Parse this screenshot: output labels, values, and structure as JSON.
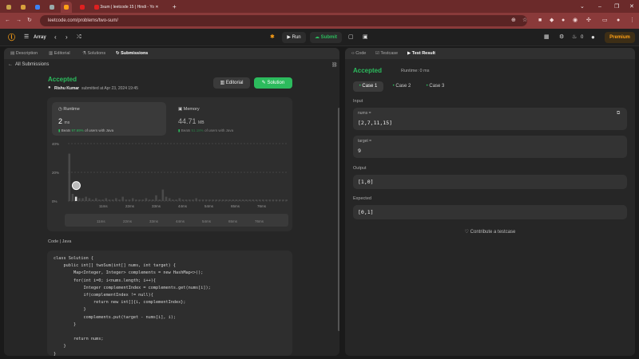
{
  "browser": {
    "tabs": [
      "3sum | leetcode 15 | Hindi - Yo"
    ],
    "url": "leetcode.com/problems/two-sum/"
  },
  "header": {
    "problem_list": "Array",
    "run": "Run",
    "submit": "Submit",
    "streak": "0",
    "premium": "Premium"
  },
  "left": {
    "tabs": [
      "Description",
      "Editorial",
      "Solutions",
      "Submissions"
    ],
    "back": "All Submissions",
    "status": "Accepted",
    "author": "Rishu Kumar",
    "submitted": "submitted at Apr 23, 2024 19:45",
    "editorial_btn": "Editorial",
    "solution_btn": "Solution",
    "runtime_label": "Runtime",
    "runtime_value": "2",
    "runtime_unit": "ms",
    "runtime_beats_prefix": "Beats",
    "runtime_beats": "97.69%",
    "runtime_beats_suffix": "of users with Java",
    "memory_label": "Memory",
    "memory_value": "44.71",
    "memory_unit": "MB",
    "memory_beats_prefix": "Beats",
    "memory_beats": "51.18%",
    "memory_beats_suffix": "of users with Java",
    "code_header": "Code",
    "code_lang": "Java",
    "code": [
      "class Solution {",
      "    public int[] twoSum(int[] nums, int target) {",
      "        Map<Integer, Integer> complements = new HashMap<>();",
      "        for(int i=0; i<nums.length; i++){",
      "            Integer complementIndex = complements.get(nums[i]);",
      "            if(complementIndex != null){",
      "                return new int[]{i, complementIndex};",
      "            }",
      "            complements.put(target - nums[i], i);",
      "        }",
      "",
      "        return nums;",
      "    }",
      "}"
    ]
  },
  "chart_data": {
    "type": "bar",
    "y_ticks": [
      "40%",
      "20%",
      "0%"
    ],
    "ylim": [
      0,
      40
    ],
    "x_ticks": [
      "11ms",
      "22ms",
      "33ms",
      "44ms",
      "54ms",
      "65ms",
      "76ms"
    ],
    "mini_ticks": [
      "11ms",
      "22ms",
      "33ms",
      "44ms",
      "54ms",
      "65ms",
      "76ms"
    ],
    "values": [
      33,
      5,
      3,
      2,
      2,
      3,
      2,
      1,
      2,
      1,
      1,
      2,
      1,
      1,
      2,
      1,
      3,
      1,
      1,
      2,
      1,
      1,
      1,
      2,
      1,
      1,
      4,
      1,
      8,
      3,
      2,
      1,
      1,
      2,
      1,
      1,
      1,
      1,
      2,
      1,
      1,
      1,
      1,
      1,
      1,
      1,
      1,
      1,
      1,
      1,
      1,
      1,
      1,
      1,
      1,
      1,
      1,
      1,
      1,
      1,
      1,
      1,
      1,
      1,
      1,
      1
    ],
    "highlight_index": 2
  },
  "right": {
    "tabs": [
      "Code",
      "Testcase",
      "Test Result"
    ],
    "status": "Accepted",
    "runtime": "Runtime: 0 ms",
    "cases": [
      "Case 1",
      "Case 2",
      "Case 3"
    ],
    "input_label": "Input",
    "nums_key": "nums =",
    "nums_val": "[2,7,11,15]",
    "target_key": "target =",
    "target_val": "9",
    "output_label": "Output",
    "output_val": "[1,0]",
    "expected_label": "Expected",
    "expected_val": "[0,1]",
    "contribute": "Contribute a testcase"
  }
}
